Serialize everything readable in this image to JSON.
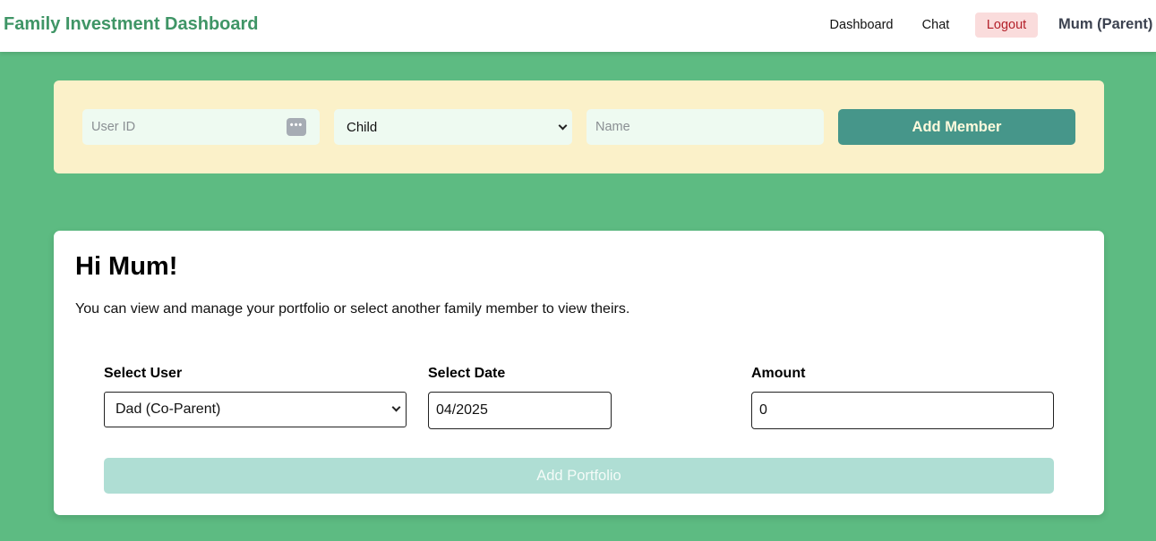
{
  "header": {
    "brand": "Family Investment Dashboard",
    "nav": {
      "dashboard": "Dashboard",
      "chat": "Chat",
      "logout": "Logout"
    },
    "user_label": "Mum (Parent)"
  },
  "member_form": {
    "user_id_placeholder": "User ID",
    "user_id_value": "",
    "role_selected": "Child",
    "name_placeholder": "Name",
    "name_value": "",
    "submit_label": "Add Member",
    "password_icon": "password-dots-icon"
  },
  "portfolio": {
    "greeting": "Hi Mum!",
    "intro": "You can view and manage your portfolio or select another family member to view theirs.",
    "select_user_label": "Select User",
    "selected_user": "Dad (Co-Parent)",
    "select_date_label": "Select Date",
    "date_value": "04/2025",
    "amount_label": "Amount",
    "amount_value": "0",
    "submit_label": "Add Portfolio"
  },
  "colors": {
    "background": "#5dbb82",
    "brand": "#3f9566",
    "panel": "#fbf1c9",
    "primary_button": "#46968a",
    "disabled_button": "#afded4",
    "logout_bg": "#fadcdc",
    "logout_text": "#b3202a"
  }
}
